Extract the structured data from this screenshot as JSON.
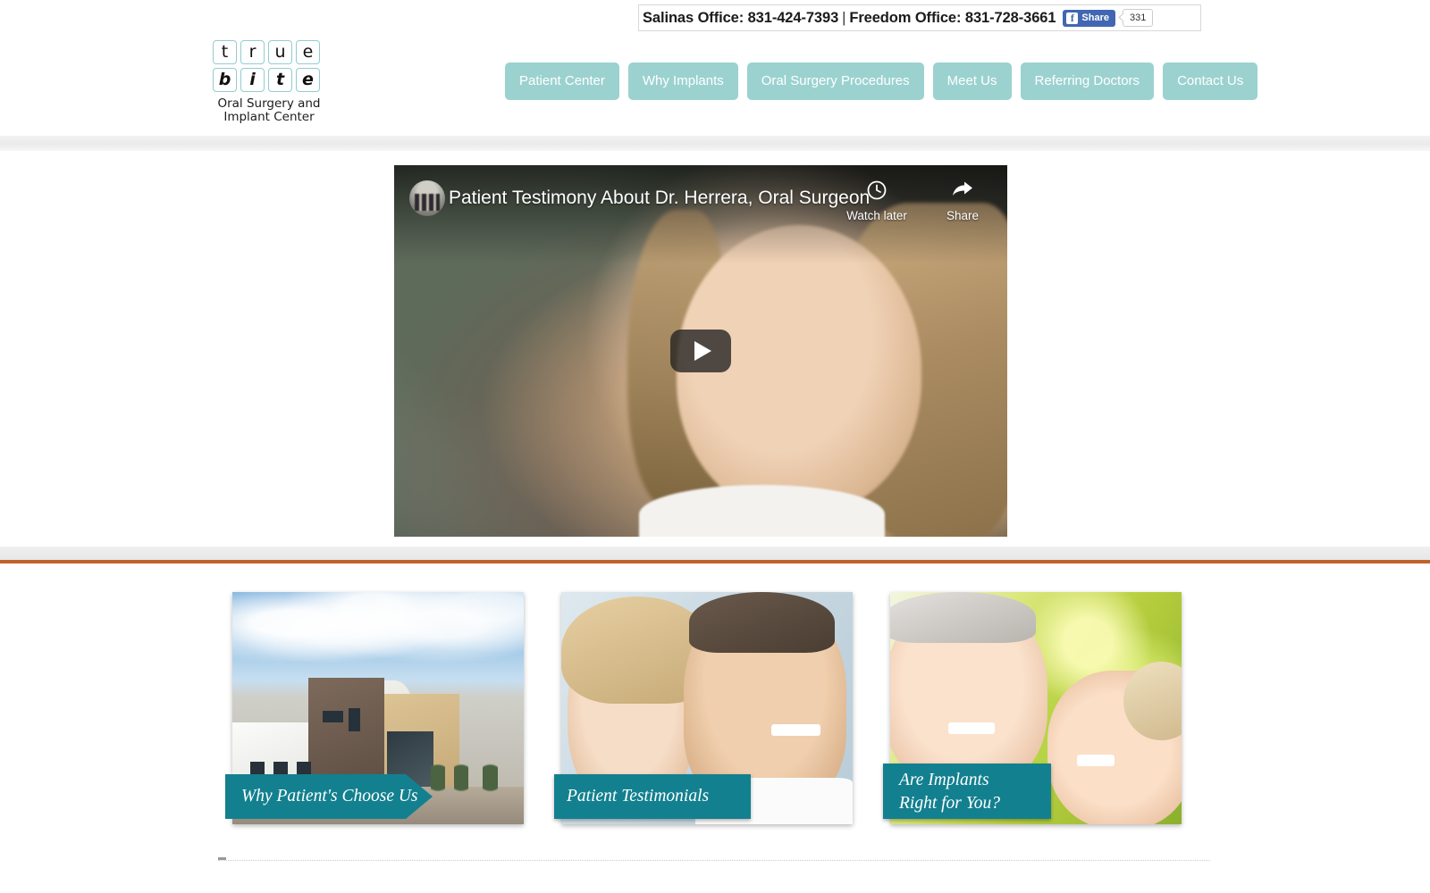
{
  "topbar": {
    "salinas_label": "Salinas Office: 831-424-7393",
    "separator": "|",
    "freedom_label": "Freedom Office: 831-728-3661",
    "facebook": {
      "icon": "f",
      "share_label": "Share",
      "count": "331"
    }
  },
  "logo": {
    "row1": [
      "t",
      "r",
      "u",
      "e"
    ],
    "row2": [
      "b",
      "i",
      "t",
      "e"
    ],
    "subtitle_line1": "Oral Surgery and",
    "subtitle_line2": "Implant Center"
  },
  "nav": {
    "items": [
      {
        "label": "Patient Center"
      },
      {
        "label": "Why Implants"
      },
      {
        "label": "Oral Surgery Procedures"
      },
      {
        "label": "Meet Us"
      },
      {
        "label": "Referring Doctors"
      },
      {
        "label": "Contact Us"
      }
    ]
  },
  "video": {
    "title": "Patient Testimony About Dr. Herrera, Oral Surgeon in Sali...",
    "watch_later_label": "Watch later",
    "share_label": "Share",
    "play_label": "Play"
  },
  "cards": [
    {
      "caption": "Why Patient's Choose Us",
      "caption_line2": ""
    },
    {
      "caption": "Patient Testimonials",
      "caption_line2": ""
    },
    {
      "caption": "Are  Implants",
      "caption_line2": "Right for You?"
    }
  ],
  "colors": {
    "nav_button": "#9bd2d0",
    "banner_teal": "#13808f",
    "divider_orange": "#c1622c",
    "facebook_blue": "#4267b2",
    "logo_border": "#93ccd0"
  }
}
